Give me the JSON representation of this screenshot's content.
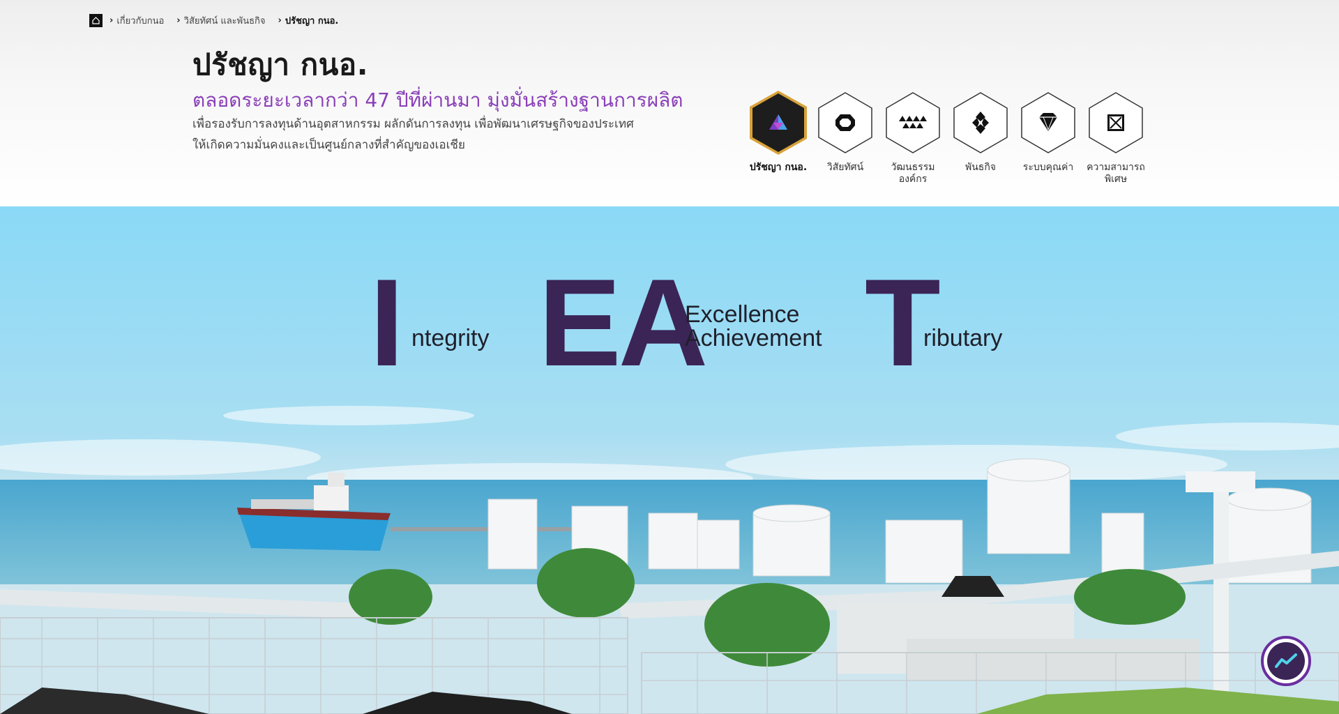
{
  "breadcrumb": {
    "items": [
      "เกี่ยวกับกนอ",
      "วิสัยทัศน์ และพันธกิจ",
      "ปรัชญา กนอ."
    ]
  },
  "page": {
    "title": "ปรัชญา กนอ.",
    "subtitle": "ตลอดระยะเวลากว่า 47 ปีที่ผ่านมา มุ่งมั่นสร้างฐานการผลิต",
    "description_line1": "เพื่อรองรับการลงทุนด้านอุตสาหกรรม ผลักดันการลงทุน เพื่อพัฒนาเศรษฐกิจของประเทศ",
    "description_line2": "ให้เกิดความมั่นคงและเป็นศูนย์กลางที่สำคัญของเอเชีย"
  },
  "hexnav": [
    {
      "label": "ปรัชญา กนอ.",
      "icon": "pyramid-icon",
      "active": true
    },
    {
      "label": "วิสัยทัศน์",
      "icon": "octagon-ring-icon",
      "active": false
    },
    {
      "label": "วัฒนธรรมองค์กร",
      "icon": "triangles-icon",
      "active": false
    },
    {
      "label": "พันธกิจ",
      "icon": "diamond-cross-icon",
      "active": false
    },
    {
      "label": "ระบบคุณค่า",
      "icon": "gem-icon",
      "active": false
    },
    {
      "label": "ความสามารถพิเศษ",
      "icon": "square-x-icon",
      "active": false
    }
  ],
  "values": {
    "integrity": {
      "letter": "I",
      "rest": "ntegrity"
    },
    "ea": {
      "letters": "EA",
      "word1": "Excellence",
      "word2": "Achievement"
    },
    "tributary": {
      "letter": "T",
      "rest": "ributary"
    }
  },
  "colors": {
    "accent_purple": "#8a3fb8",
    "dark_purple": "#3b2456",
    "gold": "#c9962e",
    "sky": "#8ad9f6"
  }
}
